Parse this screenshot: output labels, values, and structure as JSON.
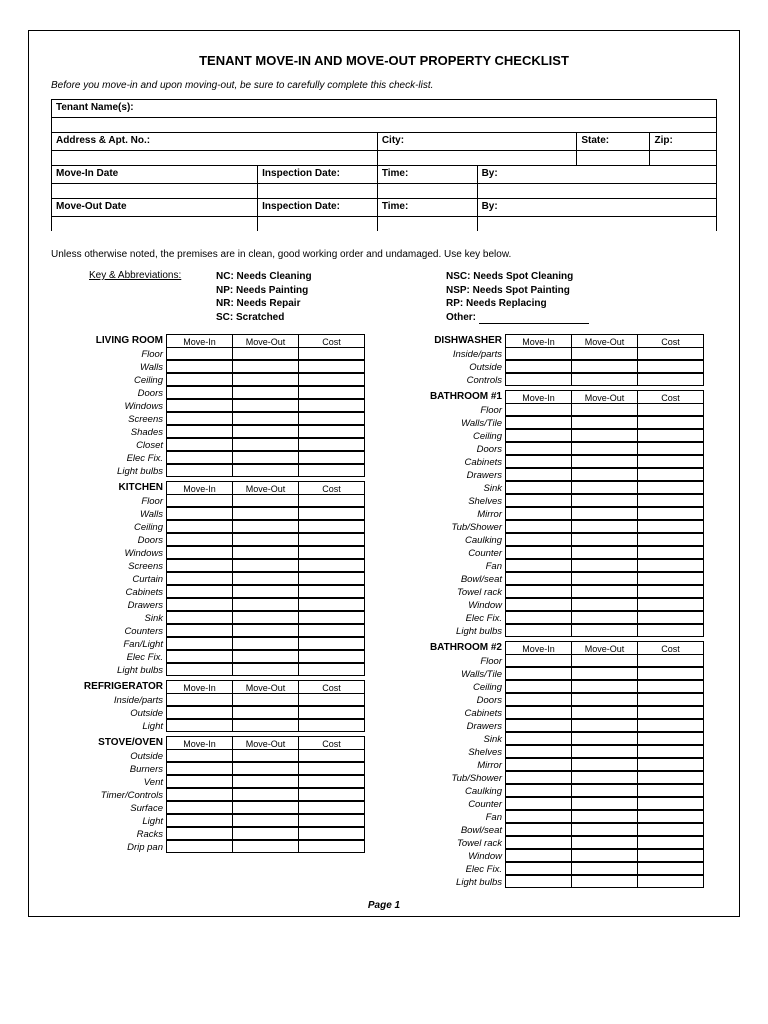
{
  "title": "TENANT MOVE-IN AND MOVE-OUT PROPERTY CHECKLIST",
  "intro": "Before you move-in and upon moving-out, be sure to carefully complete this check-list.",
  "header": {
    "tenant_names": "Tenant Name(s):",
    "address_apt": "Address & Apt. No.:",
    "city": "City:",
    "state": "State:",
    "zip": "Zip:",
    "move_in_date": "Move-In Date",
    "inspection_date": "Inspection Date:",
    "time": "Time:",
    "by": "By:",
    "move_out_date": "Move-Out Date"
  },
  "note": "Unless otherwise noted, the premises are in clean, good working order and undamaged.  Use key below.",
  "key_label": "Key & Abbreviations:",
  "keys_left": [
    {
      "code": "NC:",
      "desc": "Needs Cleaning"
    },
    {
      "code": "NP:",
      "desc": "Needs Painting"
    },
    {
      "code": "NR:",
      "desc": "Needs Repair"
    },
    {
      "code": "SC:",
      "desc": "Scratched"
    }
  ],
  "keys_right": [
    {
      "code": "NSC:",
      "desc": "Needs Spot Cleaning"
    },
    {
      "code": "NSP:",
      "desc": "Needs Spot Painting"
    },
    {
      "code": "RP:",
      "desc": "Needs Replacing"
    }
  ],
  "other_label": "Other:",
  "col_headers": [
    "Move-In",
    "Move-Out",
    "Cost"
  ],
  "left_sections": [
    {
      "title": "LIVING ROOM",
      "items": [
        "Floor",
        "Walls",
        "Ceiling",
        "Doors",
        "Windows",
        "Screens",
        "Shades",
        "Closet",
        "Elec Fix.",
        "Light bulbs"
      ]
    },
    {
      "title": "KITCHEN",
      "items": [
        "Floor",
        "Walls",
        "Ceiling",
        "Doors",
        "Windows",
        "Screens",
        "Curtain",
        "Cabinets",
        "Drawers",
        "Sink",
        "Counters",
        "Fan/Light",
        "Elec Fix.",
        "Light bulbs"
      ]
    },
    {
      "title": "REFRIGERATOR",
      "items": [
        "Inside/parts",
        "Outside",
        "Light"
      ]
    },
    {
      "title": "STOVE/OVEN",
      "items": [
        "Outside",
        "Burners",
        "Vent",
        "Timer/Controls",
        "Surface",
        "Light",
        "Racks",
        "Drip pan"
      ]
    }
  ],
  "right_sections": [
    {
      "title": "DISHWASHER",
      "items": [
        "Inside/parts",
        "Outside",
        "Controls"
      ]
    },
    {
      "title": "BATHROOM #1",
      "items": [
        "Floor",
        "Walls/Tile",
        "Ceiling",
        "Doors",
        "Cabinets",
        "Drawers",
        "Sink",
        "Shelves",
        "Mirror",
        "Tub/Shower",
        "Caulking",
        "Counter",
        "Fan",
        "Bowl/seat",
        "Towel rack",
        "Window",
        "Elec Fix.",
        "Light bulbs"
      ]
    },
    {
      "title": "BATHROOM #2",
      "items": [
        "Floor",
        "Walls/Tile",
        "Ceiling",
        "Doors",
        "Cabinets",
        "Drawers",
        "Sink",
        "Shelves",
        "Mirror",
        "Tub/Shower",
        "Caulking",
        "Counter",
        "Fan",
        "Bowl/seat",
        "Towel rack",
        "Window",
        "Elec Fix.",
        "Light bulbs"
      ]
    }
  ],
  "page_num": "Page 1"
}
